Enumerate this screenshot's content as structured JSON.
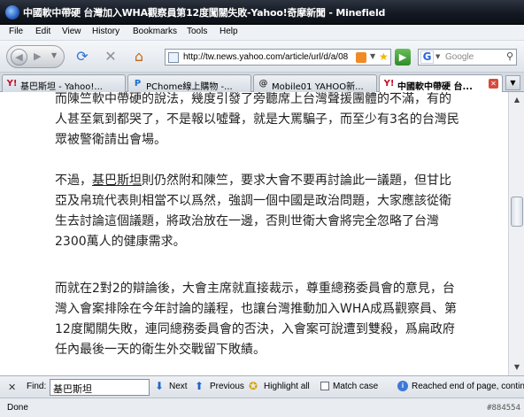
{
  "window": {
    "title": "中國軟中帶硬 台灣加入WHA觀察員第12度闖關失敗-Yahoo!奇摩新聞 - Minefield"
  },
  "menu": [
    "File",
    "Edit",
    "View",
    "History",
    "Bookmarks",
    "Tools",
    "Help"
  ],
  "toolbar": {
    "url": "http://tw.news.yahoo.com/article/url/d/a/08",
    "search_placeholder": "Google",
    "search_engine_letter": "G"
  },
  "tabs": [
    {
      "icon": "Y!",
      "label": "基巴斯坦 - Yahoo!...",
      "active": false
    },
    {
      "icon": "P",
      "label": "PChome線上購物 -...",
      "active": false
    },
    {
      "icon": "@",
      "label": "Mobile01 YAHOO新...",
      "active": false
    },
    {
      "icon": "Y!",
      "label": "中國軟中帶硬 台...",
      "active": true
    }
  ],
  "content": {
    "paragraphs": [
      {
        "lines": [
          "而陳竺軟中帶硬的說法，幾度引發了旁聽席上台灣聲援團體的不滿，有的",
          "人甚至氣到都哭了，不是報以噓聲，就是大罵騙子，而至少有3名的台灣民",
          "眾被警衛請出會場。"
        ]
      },
      {
        "lines": [
          "不過，基巴斯坦則仍然附和陳竺，要求大會不要再討論此一議題，但甘比",
          "亞及帛琉代表則相當不以爲然，強調一個中國是政治問題，大家應該從衛",
          "生去討論這個議題，將政治放在一邊，否則世衛大會將完全忽略了台灣",
          "2300萬人的健康需求。"
        ],
        "highlight": "基巴斯坦"
      },
      {
        "lines": [
          "而就在2對2的辯論後，大會主席就直接裁示，尊重總務委員會的意見，台",
          "灣入會案排除在今年討論的議程，也讓台灣推動加入WHA成爲觀察員、第",
          "12度闖關失敗，連同總務委員會的否決，入會案可說遭到雙殺，爲扁政府",
          "任內最後一天的衛生外交戰留下敗績。"
        ]
      }
    ]
  },
  "findbar": {
    "label": "Find:",
    "value": "基巴斯坦",
    "next": "Next",
    "previous": "Previous",
    "highlight_all": "Highlight all",
    "match_case": "Match case",
    "status": "Reached end of page, continued from top"
  },
  "statusbar": {
    "text": "Done",
    "watermark": "#884554"
  }
}
